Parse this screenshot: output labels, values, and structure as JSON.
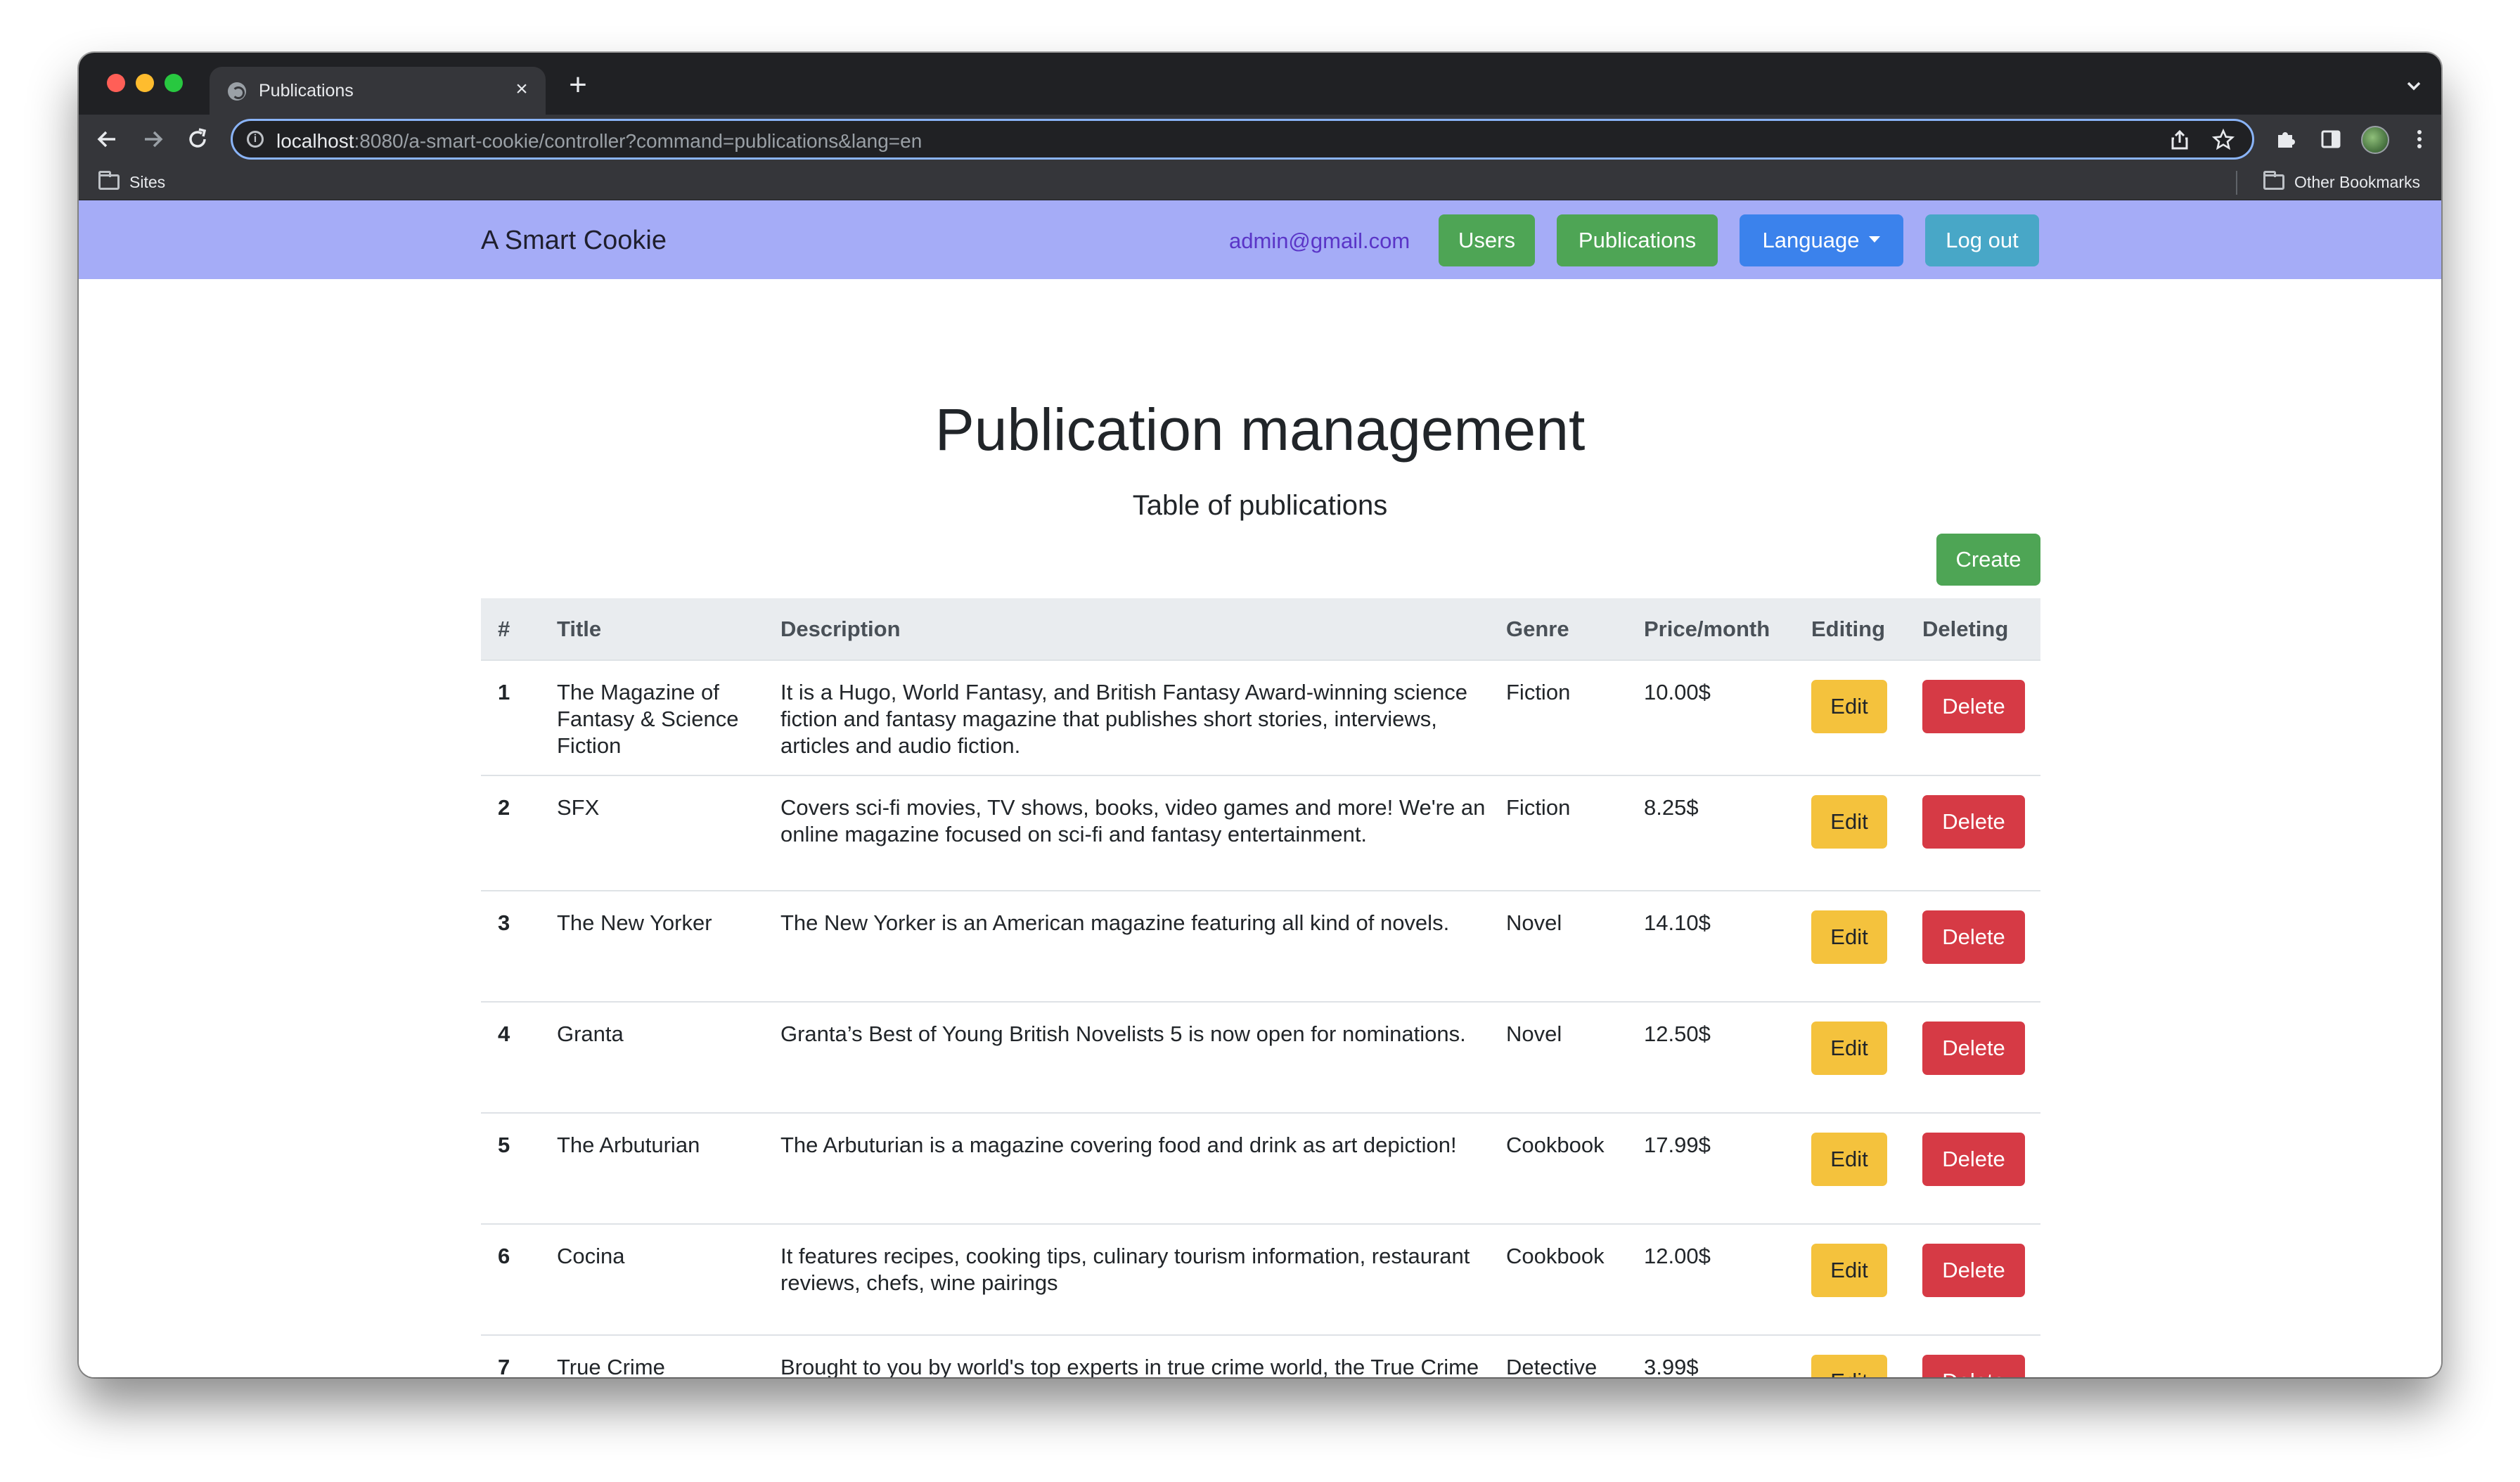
{
  "browser": {
    "tab_title": "Publications",
    "tab_close": "×",
    "new_tab": "+",
    "url_host": "localhost",
    "url_rest": ":8080/a-smart-cookie/controller?command=publications&lang=en",
    "bookmarks": {
      "sites": "Sites",
      "other": "Other Bookmarks"
    },
    "icons": [
      "back-icon",
      "forward-icon",
      "reload-icon",
      "info-icon",
      "share-icon",
      "star-icon",
      "extensions-icon",
      "side-panel-icon",
      "menu-icon"
    ]
  },
  "navbar": {
    "brand": "A Smart Cookie",
    "email": "admin@gmail.com",
    "users_label": "Users",
    "publications_label": "Publications",
    "language_label": "Language",
    "logout_label": "Log out"
  },
  "main": {
    "title": "Publication management",
    "subtitle": "Table of publications",
    "create_label": "Create"
  },
  "table": {
    "headers": {
      "num": "#",
      "title": "Title",
      "description": "Description",
      "genre": "Genre",
      "price": "Price/month",
      "editing": "Editing",
      "deleting": "Deleting"
    },
    "edit_label": "Edit",
    "delete_label": "Delete",
    "rows": [
      {
        "num": "1",
        "title": "The Magazine of Fantasy & Science Fiction",
        "description": "It is a Hugo, World Fantasy, and British Fantasy Award-winning science fiction and fantasy magazine that publishes short stories, interviews, articles and audio fiction.",
        "genre": "Fiction",
        "price": "10.00$"
      },
      {
        "num": "2",
        "title": "SFX",
        "description": "Covers sci-fi movies, TV shows, books, video games and more! We're an online magazine focused on sci-fi and fantasy entertainment.",
        "genre": "Fiction",
        "price": "8.25$"
      },
      {
        "num": "3",
        "title": "The New Yorker",
        "description": "The New Yorker is an American magazine featuring all kind of novels.",
        "genre": "Novel",
        "price": "14.10$"
      },
      {
        "num": "4",
        "title": "Granta",
        "description": "Granta’s Best of Young British Novelists 5 is now open for nominations.",
        "genre": "Novel",
        "price": "12.50$"
      },
      {
        "num": "5",
        "title": "The Arbuturian",
        "description": "The Arbuturian is a magazine covering food and drink as art depiction!",
        "genre": "Cookbook",
        "price": "17.99$"
      },
      {
        "num": "6",
        "title": "Cocina",
        "description": "It features recipes, cooking tips, culinary tourism information, restaurant reviews, chefs, wine pairings",
        "genre": "Cookbook",
        "price": "12.00$"
      },
      {
        "num": "7",
        "title": "True Crime",
        "description": "Brought to you by world's top experts in true crime world, the True Crime e-Magazine offers an exclusive and fascinating journey through the criminal mind!",
        "genre": "Detective",
        "price": "3.99$"
      }
    ]
  },
  "colors": {
    "navbar_bg": "#a5acf7",
    "success": "#4ea555",
    "primary": "#3b82ec",
    "info": "#48a7c7",
    "warning": "#f4c23d",
    "danger": "#d63a45"
  }
}
